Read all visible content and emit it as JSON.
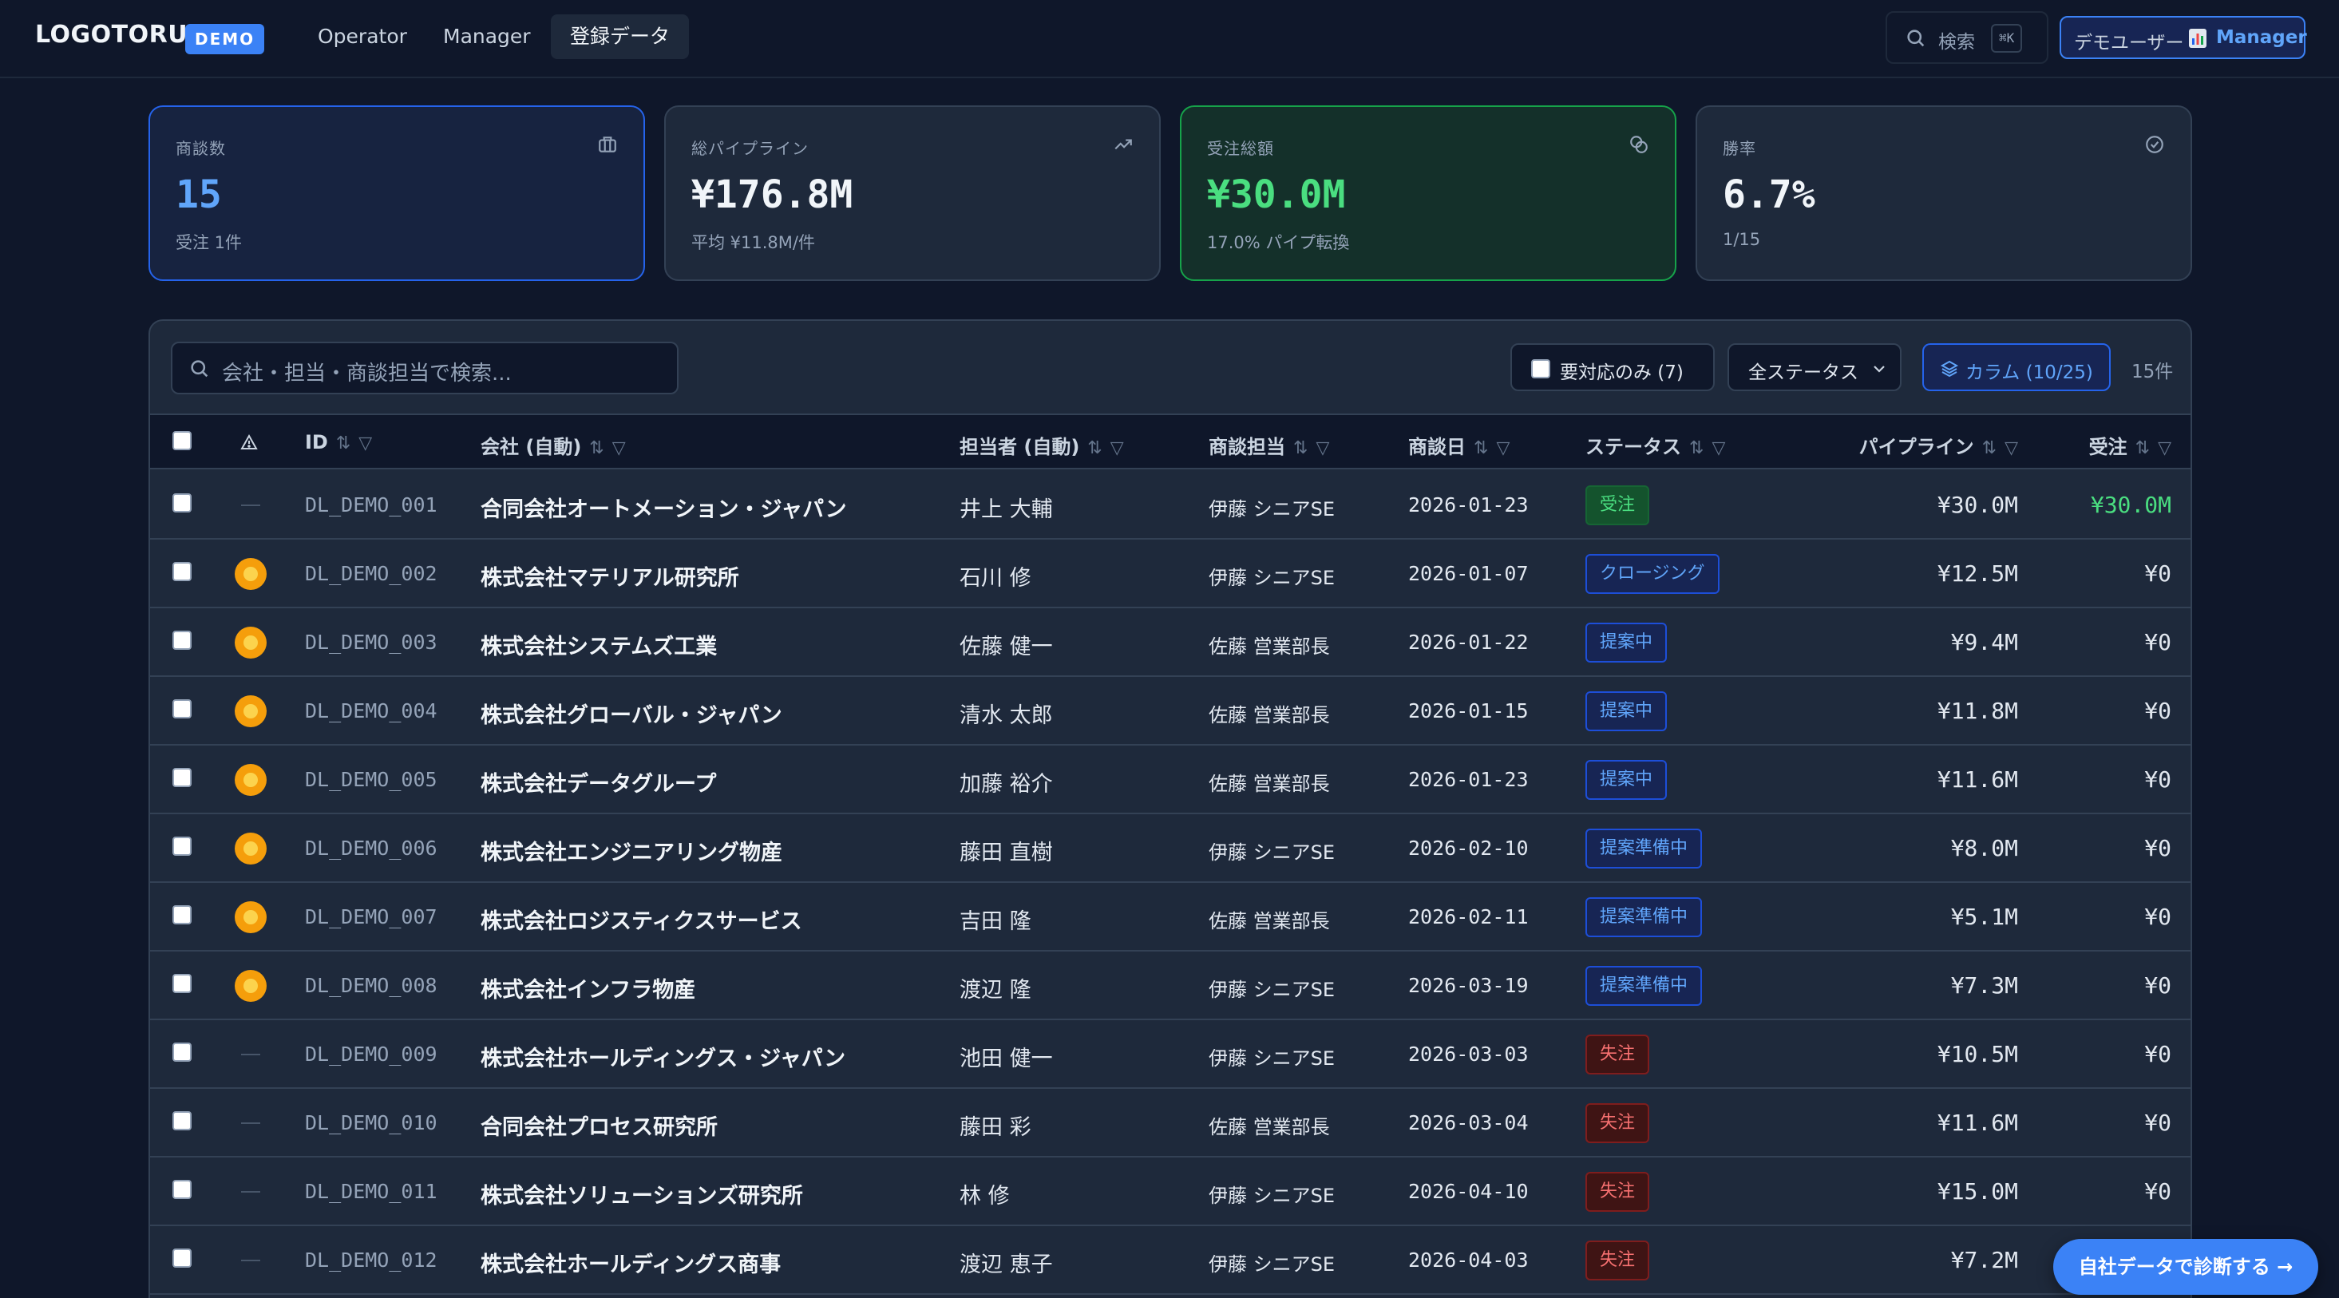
{
  "header": {
    "logo": "LOGOTORU",
    "badge": "DEMO",
    "nav": [
      {
        "label": "Operator"
      },
      {
        "label": "Manager"
      },
      {
        "label": "登録データ"
      }
    ],
    "search_label": "検索",
    "search_kbd": "⌘K",
    "user_name": "デモユーザー",
    "user_role": "Manager"
  },
  "kpis": [
    {
      "label": "商談数",
      "value": "15",
      "sub": "受注 1件",
      "icon": "briefcase-icon"
    },
    {
      "label": "総パイプライン",
      "value": "¥176.8M",
      "sub": "平均 ¥11.8M/件",
      "icon": "trending-up-icon"
    },
    {
      "label": "受注総額",
      "value": "¥30.0M",
      "sub": "17.0% パイプ転換",
      "icon": "coins-icon"
    },
    {
      "label": "勝率",
      "value": "6.7%",
      "sub": "1/15",
      "icon": "check-circle-icon"
    }
  ],
  "toolbar": {
    "search_placeholder": "会社・担当・商談担当で検索...",
    "needs_action_label": "要対応のみ (7)",
    "status_select": "全ステータス",
    "columns_label": "カラム (10/25)",
    "count": "15件"
  },
  "columns": {
    "id": "ID",
    "company": "会社 (自動)",
    "contact": "担当者 (自動)",
    "owner": "商談担当",
    "date": "商談日",
    "status": "ステータス",
    "pipeline": "パイプライン",
    "won": "受注"
  },
  "rows": [
    {
      "id": "DL_DEMO_001",
      "alert": false,
      "company": "合同会社オートメーション・ジャパン",
      "contact": "井上 大輔",
      "owner": "伊藤 シニアSE",
      "date": "2026-01-23",
      "status": "受注",
      "status_kind": "won",
      "pipeline": "¥30.0M",
      "won": "¥30.0M"
    },
    {
      "id": "DL_DEMO_002",
      "alert": true,
      "company": "株式会社マテリアル研究所",
      "contact": "石川 修",
      "owner": "伊藤 シニアSE",
      "date": "2026-01-07",
      "status": "クロージング",
      "status_kind": "closing",
      "pipeline": "¥12.5M",
      "won": "¥0"
    },
    {
      "id": "DL_DEMO_003",
      "alert": true,
      "company": "株式会社システムズ工業",
      "contact": "佐藤 健一",
      "owner": "佐藤 営業部長",
      "date": "2026-01-22",
      "status": "提案中",
      "status_kind": "proposal",
      "pipeline": "¥9.4M",
      "won": "¥0"
    },
    {
      "id": "DL_DEMO_004",
      "alert": true,
      "company": "株式会社グローバル・ジャパン",
      "contact": "清水 太郎",
      "owner": "佐藤 営業部長",
      "date": "2026-01-15",
      "status": "提案中",
      "status_kind": "proposal",
      "pipeline": "¥11.8M",
      "won": "¥0"
    },
    {
      "id": "DL_DEMO_005",
      "alert": true,
      "company": "株式会社データグループ",
      "contact": "加藤 裕介",
      "owner": "佐藤 営業部長",
      "date": "2026-01-23",
      "status": "提案中",
      "status_kind": "proposal",
      "pipeline": "¥11.6M",
      "won": "¥0"
    },
    {
      "id": "DL_DEMO_006",
      "alert": true,
      "company": "株式会社エンジニアリング物産",
      "contact": "藤田 直樹",
      "owner": "伊藤 シニアSE",
      "date": "2026-02-10",
      "status": "提案準備中",
      "status_kind": "prep",
      "pipeline": "¥8.0M",
      "won": "¥0"
    },
    {
      "id": "DL_DEMO_007",
      "alert": true,
      "company": "株式会社ロジスティクスサービス",
      "contact": "吉田 隆",
      "owner": "佐藤 営業部長",
      "date": "2026-02-11",
      "status": "提案準備中",
      "status_kind": "prep",
      "pipeline": "¥5.1M",
      "won": "¥0"
    },
    {
      "id": "DL_DEMO_008",
      "alert": true,
      "company": "株式会社インフラ物産",
      "contact": "渡辺 隆",
      "owner": "伊藤 シニアSE",
      "date": "2026-03-19",
      "status": "提案準備中",
      "status_kind": "prep",
      "pipeline": "¥7.3M",
      "won": "¥0"
    },
    {
      "id": "DL_DEMO_009",
      "alert": false,
      "company": "株式会社ホールディングス・ジャパン",
      "contact": "池田 健一",
      "owner": "伊藤 シニアSE",
      "date": "2026-03-03",
      "status": "失注",
      "status_kind": "lost",
      "pipeline": "¥10.5M",
      "won": "¥0"
    },
    {
      "id": "DL_DEMO_010",
      "alert": false,
      "company": "合同会社プロセス研究所",
      "contact": "藤田 彩",
      "owner": "佐藤 営業部長",
      "date": "2026-03-04",
      "status": "失注",
      "status_kind": "lost",
      "pipeline": "¥11.6M",
      "won": "¥0"
    },
    {
      "id": "DL_DEMO_011",
      "alert": false,
      "company": "株式会社ソリューションズ研究所",
      "contact": "林 修",
      "owner": "伊藤 シニアSE",
      "date": "2026-04-10",
      "status": "失注",
      "status_kind": "lost",
      "pipeline": "¥15.0M",
      "won": "¥0"
    },
    {
      "id": "DL_DEMO_012",
      "alert": false,
      "company": "株式会社ホールディングス商事",
      "contact": "渡辺 恵子",
      "owner": "伊藤 シニアSE",
      "date": "2026-04-03",
      "status": "失注",
      "status_kind": "lost",
      "pipeline": "¥7.2M",
      "won": ""
    }
  ],
  "cta_label": "自社データで診断する →",
  "colors": {
    "background": "#0f172a",
    "accent": "#3b82f6",
    "success": "#4ade80",
    "danger": "#f87171",
    "warning": "#f59e0b"
  }
}
